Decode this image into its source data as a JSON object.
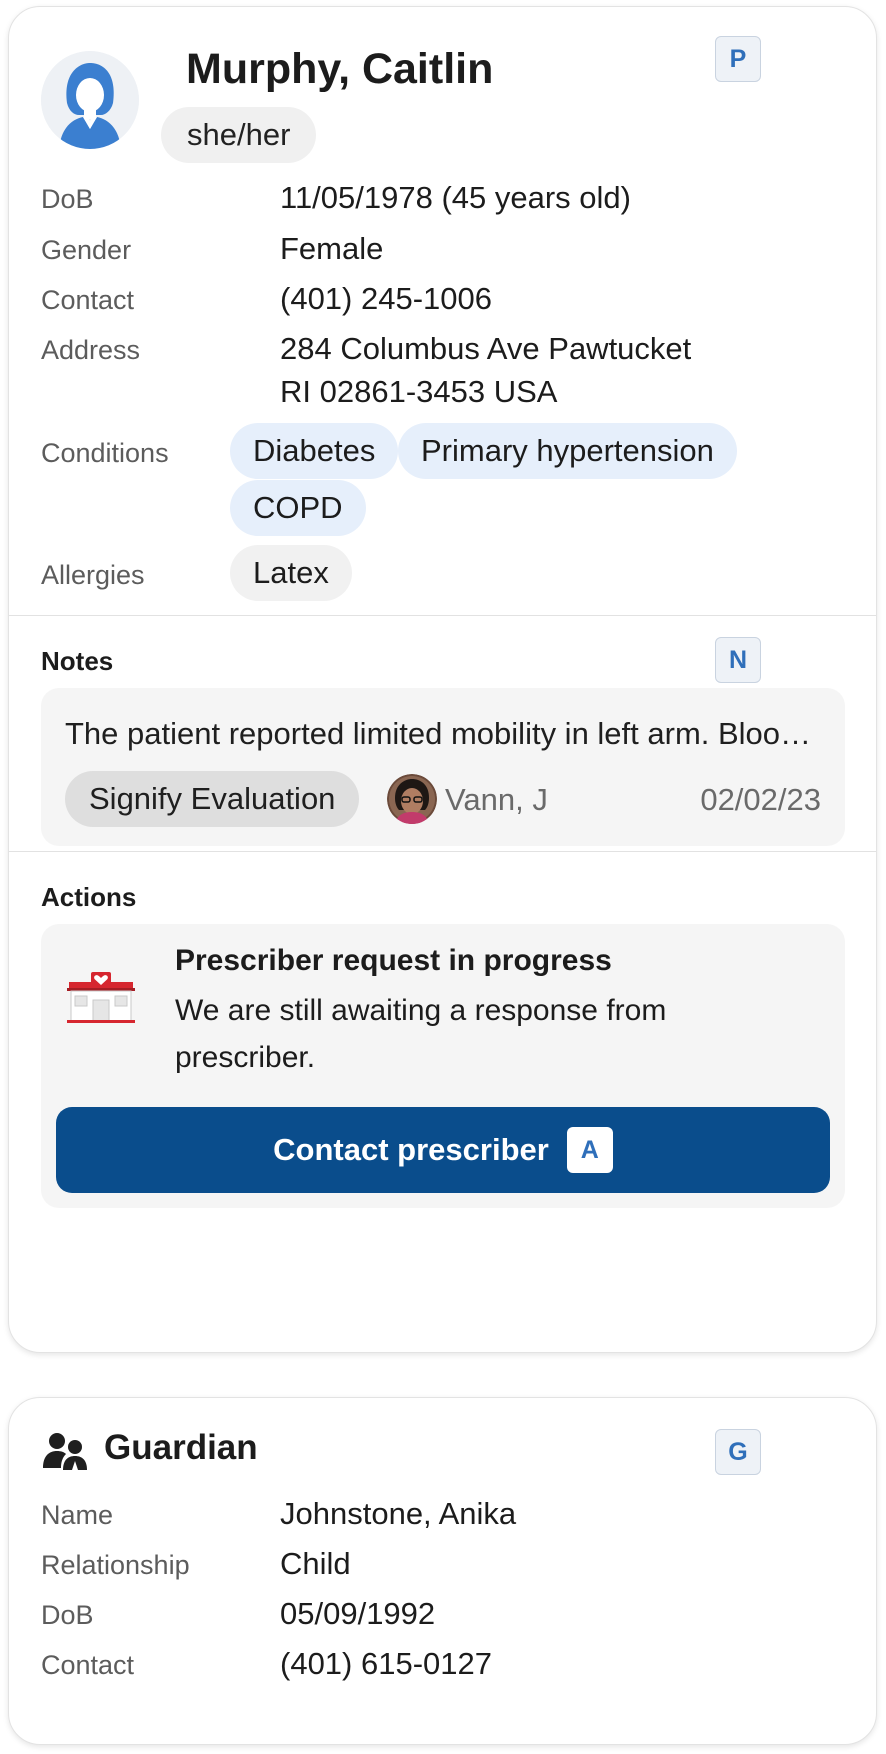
{
  "patient": {
    "name": "Murphy, Caitlin",
    "pronouns": "she/her",
    "shortcut": "P",
    "fields": {
      "dob_label": "DoB",
      "dob_value": "11/05/1978 (45 years old)",
      "gender_label": "Gender",
      "gender_value": "Female",
      "contact_label": "Contact",
      "contact_value": "(401) 245-1006",
      "address_label": "Address",
      "address_line1": "284 Columbus Ave Pawtucket",
      "address_line2": "RI 02861-3453 USA",
      "conditions_label": "Conditions",
      "allergies_label": "Allergies"
    },
    "conditions": [
      "Diabetes",
      "Primary hypertension",
      "COPD"
    ],
    "allergies": [
      "Latex"
    ]
  },
  "notes": {
    "title": "Notes",
    "shortcut": "N",
    "text": "The patient reported limited mobility in left arm. Blood pressure remains elevated.",
    "tag": "Signify Evaluation",
    "author": "Vann, J",
    "date": "02/02/23"
  },
  "actions": {
    "title": "Actions",
    "item_title": "Prescriber request in progress",
    "item_desc": "We are still awaiting a response from prescriber.",
    "button_label": "Contact prescriber",
    "button_shortcut": "A"
  },
  "guardian": {
    "title": "Guardian",
    "shortcut": "G",
    "name_label": "Name",
    "name_value": "Johnstone, Anika",
    "relationship_label": "Relationship",
    "relationship_value": "Child",
    "dob_label": "DoB",
    "dob_value": "05/09/1992",
    "contact_label": "Contact",
    "contact_value": "(401) 615-0127"
  },
  "colors": {
    "primary_button": "#0a4d8c",
    "shortcut_text": "#2f6fba",
    "condition_chip": "#e6effb",
    "pharmacy_red": "#d6262f"
  },
  "icons": {
    "patient_avatar": "female-user-avatar-icon",
    "pharmacy": "pharmacy-store-icon",
    "guardian": "guardian-people-icon"
  }
}
